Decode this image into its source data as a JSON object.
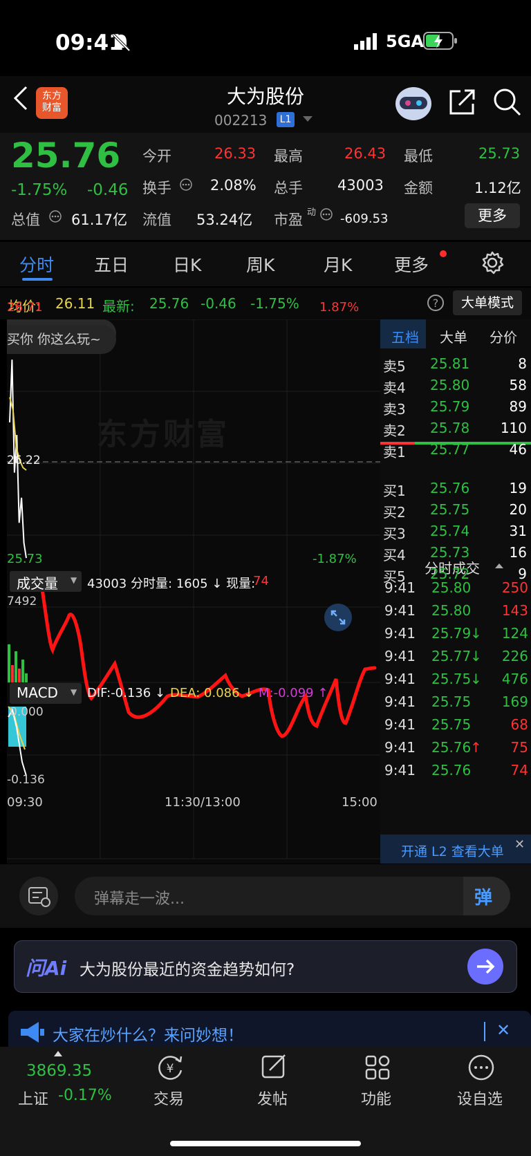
{
  "status_bar": {
    "time": "09:41",
    "network": "5GA"
  },
  "header": {
    "title": "大为股份",
    "code": "002213",
    "level_badge": "L1",
    "logo_text": "东方\n财富"
  },
  "quote": {
    "price": "25.76",
    "change_pct": "-1.75%",
    "change_abs": "-0.46",
    "open_label": "今开",
    "open": "26.33",
    "high_label": "最高",
    "high": "26.43",
    "low_label": "最低",
    "low": "25.73",
    "turnover_label": "换手",
    "turnover": "2.08%",
    "volume_label": "总手",
    "volume": "43003",
    "amount_label": "金额",
    "amount": "1.12亿",
    "mktcap_label": "总值",
    "mktcap": "61.17亿",
    "float_label": "流值",
    "float": "53.24亿",
    "pe_label": "市盈",
    "pe_sup": "动",
    "pe": "-609.53",
    "more_button": "更多"
  },
  "tabs": [
    "分时",
    "五日",
    "日K",
    "周K",
    "月K",
    "更多"
  ],
  "info_row": {
    "avg_label": "均价:",
    "avg": "26.11",
    "latest_label": "最新:",
    "latest": "25.76",
    "chg": "-0.46",
    "pct": "-1.75%",
    "mode_button": "大单模式"
  },
  "chart": {
    "top_price": "26.71",
    "top_pct": "1.87%",
    "mid_price": "26.22",
    "bot_price": "25.73",
    "bot_pct": "-1.87%",
    "watermark": "东方财富",
    "danmu_bubble": "买你 你这么玩~",
    "vol_label": "成交量",
    "vol_info": "43003 分时量: 1605 ↓ 现量:",
    "vol_now": "74",
    "vol_max": "7492",
    "macd_label": "MACD",
    "dif": "DIF:-0.136 ↓",
    "dea": "DEA: 0.086 ↓",
    "m": "M:-0.099 ↑",
    "macd_top": "0.000",
    "macd_bot": "-0.136",
    "time_start": "09:30",
    "time_mid": "11:30/13:00",
    "time_end": "15:00"
  },
  "chart_data": {
    "type": "line",
    "title": "",
    "xlabel": "",
    "ylabel": "",
    "x_ticks": [
      "09:30",
      "11:30/13:00",
      "15:00"
    ],
    "ylim": [
      25.73,
      26.71
    ],
    "reference_price": 26.22,
    "series": [
      {
        "values": [
          26.3,
          26.55,
          26.1,
          26.25,
          25.9,
          26.0,
          25.82,
          25.76
        ]
      },
      {
        "values": [
          26.4,
          26.35,
          26.2,
          26.15,
          26.12,
          26.11
        ]
      }
    ]
  },
  "book": {
    "tabs": [
      "五档",
      "大单",
      "分价"
    ],
    "asks": [
      {
        "label": "卖5",
        "price": "25.81",
        "vol": "8"
      },
      {
        "label": "卖4",
        "price": "25.80",
        "vol": "58"
      },
      {
        "label": "卖3",
        "price": "25.79",
        "vol": "89"
      },
      {
        "label": "卖2",
        "price": "25.78",
        "vol": "110"
      },
      {
        "label": "卖1",
        "price": "25.77",
        "vol": "46"
      }
    ],
    "bids": [
      {
        "label": "买1",
        "price": "25.76",
        "vol": "19"
      },
      {
        "label": "买2",
        "price": "25.75",
        "vol": "20"
      },
      {
        "label": "买3",
        "price": "25.74",
        "vol": "31"
      },
      {
        "label": "买4",
        "price": "25.73",
        "vol": "16"
      },
      {
        "label": "买5",
        "price": "25.72",
        "vol": "9"
      }
    ],
    "trades_title": "分时成交",
    "trades": [
      {
        "t": "9:41",
        "p": "25.80",
        "v": "250",
        "dir": "",
        "vc": "red"
      },
      {
        "t": "9:41",
        "p": "25.80",
        "v": "143",
        "dir": "",
        "vc": "red"
      },
      {
        "t": "9:41",
        "p": "25.79",
        "v": "124",
        "dir": "↓",
        "vc": "green"
      },
      {
        "t": "9:41",
        "p": "25.77",
        "v": "226",
        "dir": "↓",
        "vc": "green"
      },
      {
        "t": "9:41",
        "p": "25.75",
        "v": "476",
        "dir": "↓",
        "vc": "green"
      },
      {
        "t": "9:41",
        "p": "25.75",
        "v": "169",
        "dir": "",
        "vc": "green"
      },
      {
        "t": "9:41",
        "p": "25.75",
        "v": "68",
        "dir": "",
        "vc": "red"
      },
      {
        "t": "9:41",
        "p": "25.76",
        "v": "75",
        "dir": "↑",
        "vc": "red"
      },
      {
        "t": "9:41",
        "p": "25.76",
        "v": "74",
        "dir": "",
        "vc": "red"
      }
    ],
    "l2_link": "开通 L2 查看大单"
  },
  "danmu": {
    "placeholder": "弹幕走一波...",
    "send": "弹"
  },
  "ai": {
    "logo": "问Ai",
    "question": "大为股份最近的资金趋势如何?"
  },
  "ad": {
    "text": "大家在炒什么？来问妙想！"
  },
  "nav": {
    "index_value": "3869.35",
    "index_name": "上证",
    "index_pct": "-0.17%",
    "items": [
      "交易",
      "发帖",
      "功能",
      "设自选"
    ]
  }
}
